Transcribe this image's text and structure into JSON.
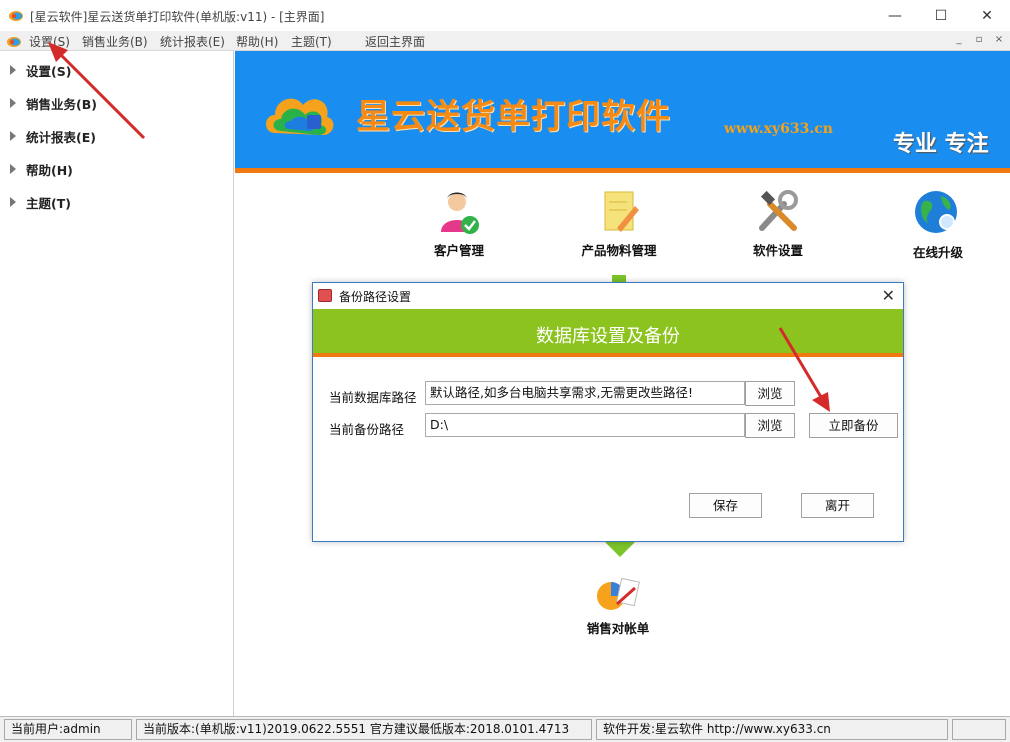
{
  "colors": {
    "banner_bg": "#1a8ef0",
    "banner_text": "#f58a14",
    "accent_orange": "#f07a10",
    "dialog_header_green": "#8cc31f",
    "annotation_arrow_red": "#d42a2a"
  },
  "window": {
    "title": "[星云软件]星云送货单打印软件(单机版:v11) - [主界面]",
    "minimize": "—",
    "maximize": "☐",
    "close": "✕"
  },
  "menu": {
    "items": [
      "设置(S)",
      "销售业务(B)",
      "统计报表(E)",
      "帮助(H)",
      "主题(T)",
      "返回主界面"
    ],
    "mdi_minimize": "_",
    "mdi_restore": "▫",
    "mdi_close": "×"
  },
  "sidebar": {
    "items": [
      "设置(S)",
      "销售业务(B)",
      "统计报表(E)",
      "帮助(H)",
      "主题(T)"
    ]
  },
  "banner": {
    "title": "星云送货单打印软件",
    "url": "www.xy633.cn",
    "slogan": "专业 专注"
  },
  "functions": {
    "customer": "客户管理",
    "product": "产品物料管理",
    "settings": "软件设置",
    "upgrade": "在线升级",
    "statement": "销售对帐单"
  },
  "dialog": {
    "title": "备份路径设置",
    "header": "数据库设置及备份",
    "db_path_label": "当前数据库路径",
    "db_path_value": "默认路径,如多台电脑共享需求,无需更改些路径!",
    "backup_path_label": "当前备份路径",
    "backup_path_value": "D:\\",
    "browse_label": "浏览",
    "backup_now_label": "立即备份",
    "save_label": "保存",
    "leave_label": "离开",
    "close": "✕"
  },
  "status": {
    "user": "当前用户:admin",
    "version": "当前版本:(单机版:v11)2019.0622.5551 官方建议最低版本:2018.0101.4713",
    "developer": "软件开发:星云软件 http://www.xy633.cn"
  }
}
